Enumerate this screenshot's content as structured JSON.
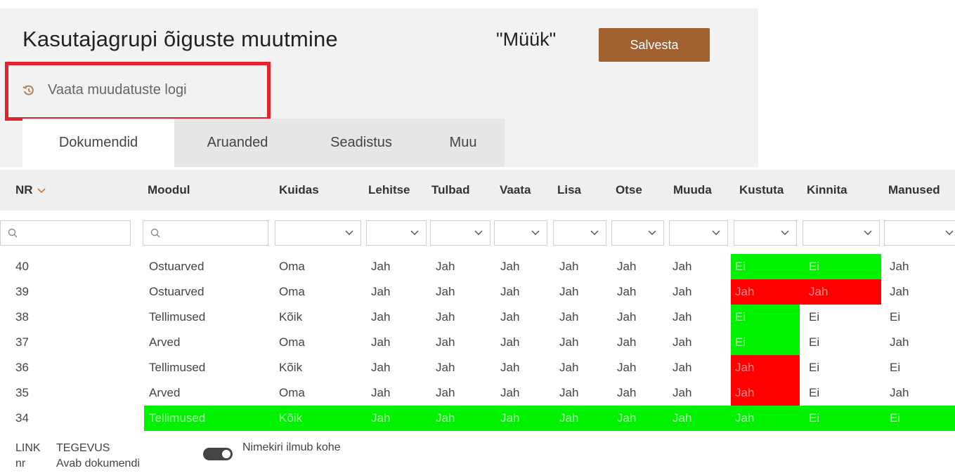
{
  "header": {
    "title": "Kasutajagrupi õiguste muutmine",
    "group_name": "\"Müük\"",
    "save_label": "Salvesta",
    "log_link": "Vaata muudatuste logi"
  },
  "tabs": [
    {
      "label": "Dokumendid",
      "active": true
    },
    {
      "label": "Aruanded",
      "active": false
    },
    {
      "label": "Seadistus",
      "active": false
    },
    {
      "label": "Muu",
      "active": false
    }
  ],
  "table": {
    "columns": [
      "NR",
      "Moodul",
      "Kuidas",
      "Lehitse",
      "Tulbad",
      "Vaata",
      "Lisa",
      "Otse",
      "Muuda",
      "Kustuta",
      "Kinnita",
      "Manused"
    ],
    "sort_column": "NR",
    "sort_direction": "descending",
    "rows": [
      [
        "40",
        "Ostuarved",
        "Oma",
        "Jah",
        "Jah",
        "Jah",
        "Jah",
        "Jah",
        "Jah",
        "Ei",
        "Ei",
        "Jah"
      ],
      [
        "39",
        "Ostuarved",
        "Oma",
        "Jah",
        "Jah",
        "Jah",
        "Jah",
        "Jah",
        "Jah",
        "Jah",
        "Jah",
        "Jah"
      ],
      [
        "38",
        "Tellimused",
        "Kõik",
        "Jah",
        "Jah",
        "Jah",
        "Jah",
        "Jah",
        "Jah",
        "Ei",
        "Ei",
        "Ei"
      ],
      [
        "37",
        "Arved",
        "Oma",
        "Jah",
        "Jah",
        "Jah",
        "Jah",
        "Jah",
        "Jah",
        "Ei",
        "Ei",
        "Jah"
      ],
      [
        "36",
        "Tellimused",
        "Kõik",
        "Jah",
        "Jah",
        "Jah",
        "Jah",
        "Jah",
        "Jah",
        "Jah",
        "Ei",
        "Ei"
      ],
      [
        "35",
        "Arved",
        "Oma",
        "Jah",
        "Jah",
        "Jah",
        "Jah",
        "Jah",
        "Jah",
        "Jah",
        "Ei",
        "Jah"
      ],
      [
        "34",
        "Tellimused",
        "Kõik",
        "Jah",
        "Jah",
        "Jah",
        "Jah",
        "Jah",
        "Jah",
        "Jah",
        "Ei",
        "Ei"
      ]
    ],
    "highlights": {
      "green": "#00f200",
      "red": "#ff0000"
    }
  },
  "legend": {
    "col1_header": "LINK",
    "col2_header": "TEGEVUS",
    "row_key": "nr",
    "row_action": "Avab dokumendi",
    "toggle_label": "Nimekiri ilmub kohe",
    "toggle_on": true
  },
  "colors": {
    "accent": "#a0602f",
    "annotation": "#e8212e"
  }
}
